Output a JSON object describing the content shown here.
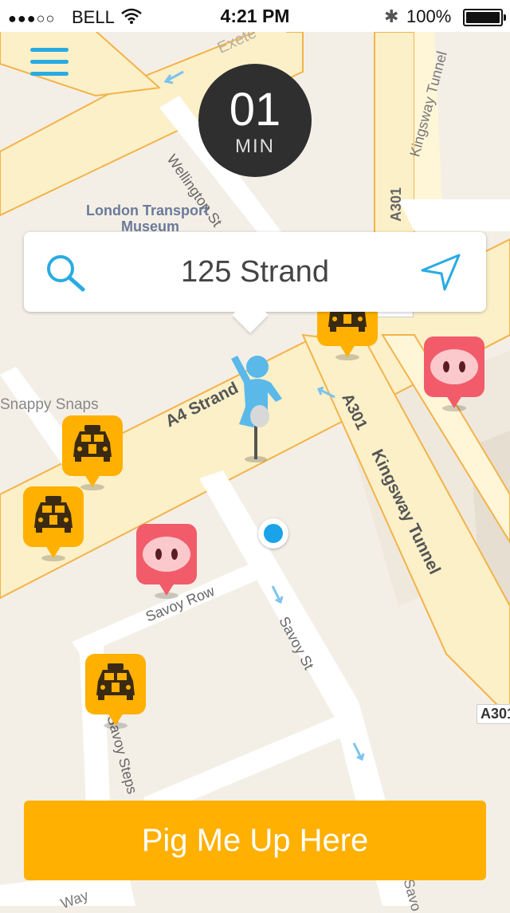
{
  "status_bar": {
    "signal": "●●●○○",
    "carrier": "BELL",
    "time": "4:21 PM",
    "battery_percent": "100%",
    "battery_level": 1.0,
    "icons": [
      "wifi-icon",
      "bluetooth-icon",
      "battery-icon"
    ]
  },
  "eta": {
    "value": "01",
    "unit": "MIN"
  },
  "search": {
    "query": "125 Strand"
  },
  "map_labels": {
    "exeter": "Exete",
    "wellington": "Wellington St",
    "museum_line1": "London Transport",
    "museum_line2": "Museum",
    "kingsway_tunnel_top": "Kingsway Tunnel",
    "a301_top": "A301",
    "a301_badge_top": "A301",
    "snappy": "Snappy Snaps",
    "strand": "A4   Strand",
    "a301_mid": "A301",
    "kingsway_tunnel": "Kingsway Tunnel",
    "savoy_row": "Savoy Row",
    "savoy_st": "Savoy St",
    "savoy_steps": "Savoy Steps",
    "a301_badge_right": "A301",
    "way_bottom": "Way",
    "savoy_bottom": "Savo"
  },
  "markers": {
    "taxi_icon": "taxi-icon",
    "pig_icon": "pig-snout-icon",
    "pickup_icon": "pickup-person-pin-icon"
  },
  "colors": {
    "accent_orange": "#ffb000",
    "pig_red": "#f25c6a",
    "brand_blue": "#29abe2",
    "location_blue": "#1aa3e8"
  },
  "cta": {
    "label": "Pig Me Up Here"
  }
}
